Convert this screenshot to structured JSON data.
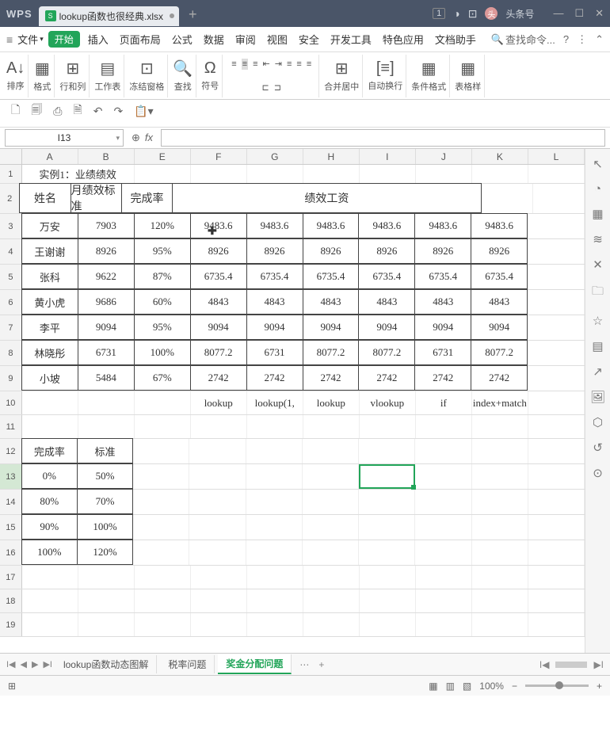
{
  "app": {
    "name": "WPS",
    "file": "lookup函数也很经典.xlsx",
    "ttr": "头条号"
  },
  "window": {
    "badge": "1"
  },
  "menu": {
    "file": "文件",
    "start": "开始",
    "insert": "插入",
    "layout": "页面布局",
    "formula": "公式",
    "data": "数据",
    "review": "审阅",
    "view": "视图",
    "security": "安全",
    "dev": "开发工具",
    "feature": "特色应用",
    "helper": "文档助手",
    "search": "查找命令..."
  },
  "ribbon": {
    "sort": "排序",
    "format": "格式",
    "rowcol": "行和列",
    "sheet": "工作表",
    "freeze": "冻结窗格",
    "find": "查找",
    "symbol": "符号",
    "merge": "合并居中",
    "wrap": "自动换行",
    "cond": "条件格式",
    "tblstyle": "表格样"
  },
  "namebox": "I13",
  "fx": "fx",
  "cols": [
    "A",
    "B",
    "E",
    "F",
    "G",
    "H",
    "I",
    "J",
    "K",
    "L"
  ],
  "r1": {
    "title": "实例1：业绩绩效"
  },
  "hdr": {
    "name": "姓名",
    "std": "月绩效标准",
    "rate": "完成率",
    "salary": "绩效工资"
  },
  "rows": [
    {
      "n": "万安",
      "s": "7903",
      "r": "120%",
      "v": [
        "9483.6",
        "9483.6",
        "9483.6",
        "9483.6",
        "9483.6",
        "9483.6"
      ]
    },
    {
      "n": "王谢谢",
      "s": "8926",
      "r": "95%",
      "v": [
        "8926",
        "8926",
        "8926",
        "8926",
        "8926",
        "8926"
      ]
    },
    {
      "n": "张科",
      "s": "9622",
      "r": "87%",
      "v": [
        "6735.4",
        "6735.4",
        "6735.4",
        "6735.4",
        "6735.4",
        "6735.4"
      ]
    },
    {
      "n": "黄小虎",
      "s": "9686",
      "r": "60%",
      "v": [
        "4843",
        "4843",
        "4843",
        "4843",
        "4843",
        "4843"
      ]
    },
    {
      "n": "李平",
      "s": "9094",
      "r": "95%",
      "v": [
        "9094",
        "9094",
        "9094",
        "9094",
        "9094",
        "9094"
      ]
    },
    {
      "n": "林晓彤",
      "s": "6731",
      "r": "100%",
      "v": [
        "8077.2",
        "6731",
        "8077.2",
        "8077.2",
        "6731",
        "8077.2"
      ]
    },
    {
      "n": "小坡",
      "s": "5484",
      "r": "67%",
      "v": [
        "2742",
        "2742",
        "2742",
        "2742",
        "2742",
        "2742"
      ]
    }
  ],
  "r10": [
    "lookup",
    "lookup(1,",
    "lookup",
    "vlookup",
    "if",
    "index+match"
  ],
  "tbl2hdr": {
    "rate": "完成率",
    "std": "标准"
  },
  "tbl2": [
    {
      "r": "0%",
      "s": "50%"
    },
    {
      "r": "80%",
      "s": "70%"
    },
    {
      "r": "90%",
      "s": "100%"
    },
    {
      "r": "100%",
      "s": "120%"
    }
  ],
  "tabs": {
    "t1": "lookup函数动态图解",
    "t2": "税率问题",
    "t3": "奖金分配问题"
  },
  "zoom": "100%"
}
